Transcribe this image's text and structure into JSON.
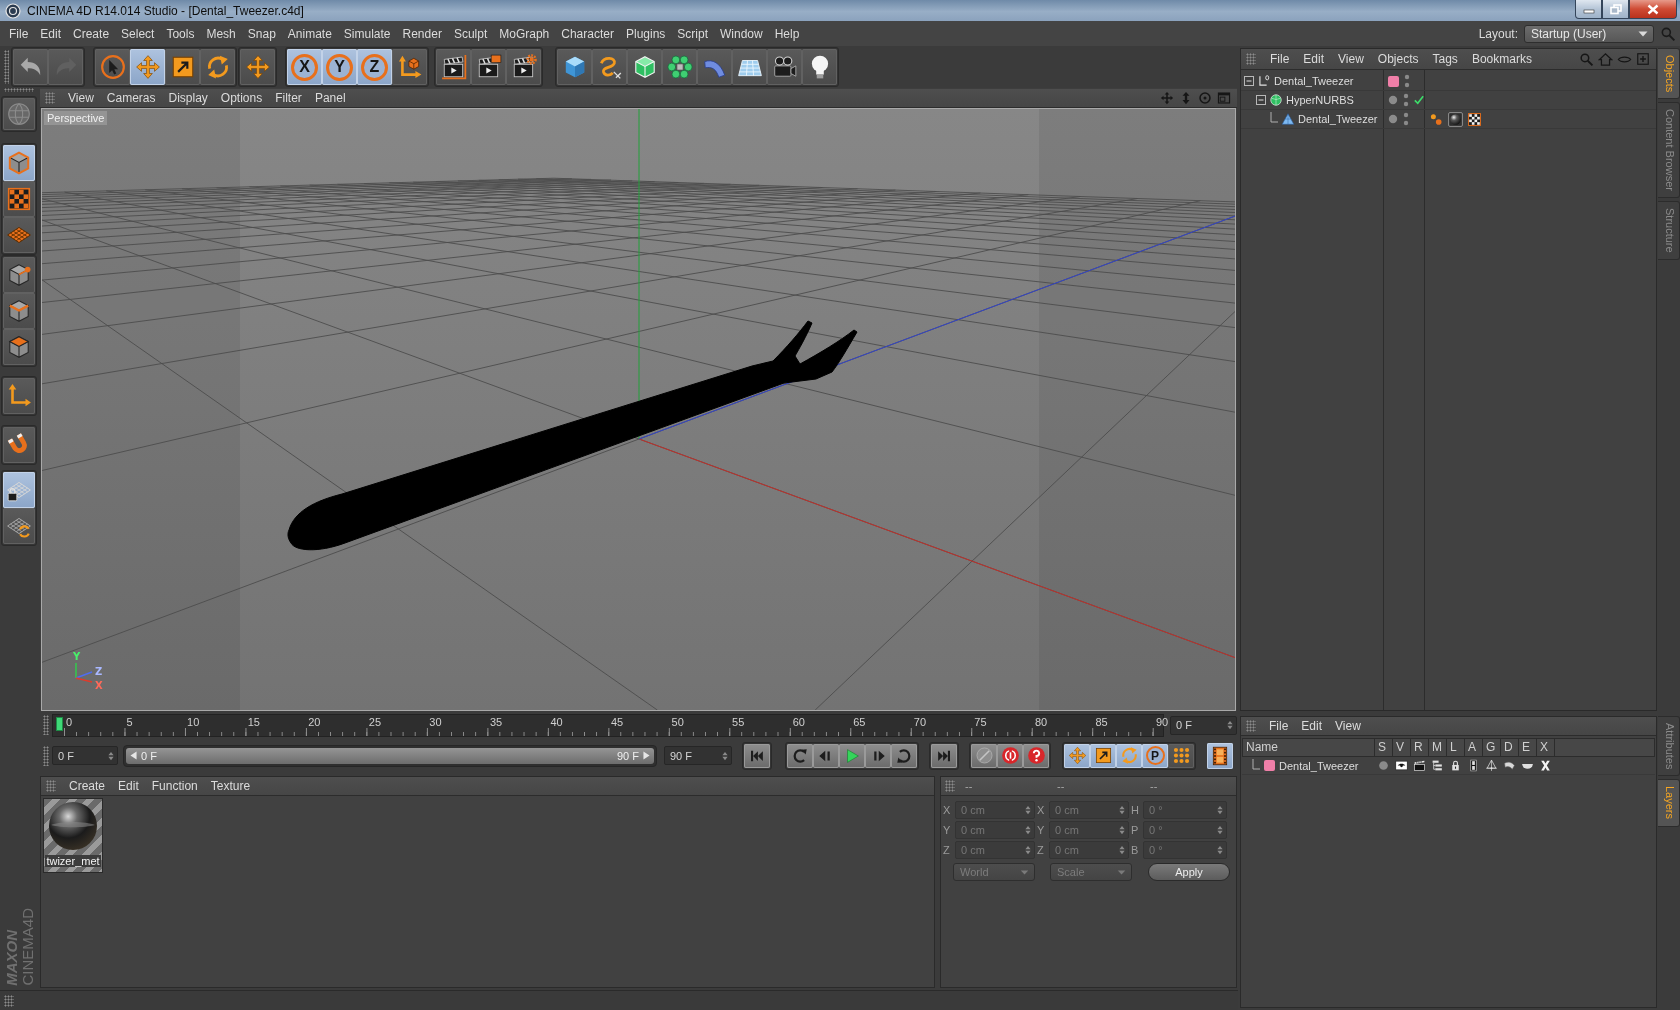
{
  "window": {
    "title": "CINEMA 4D R14.014 Studio - [Dental_Tweezer.c4d]"
  },
  "menu_bar": [
    "File",
    "Edit",
    "Create",
    "Select",
    "Tools",
    "Mesh",
    "Snap",
    "Animate",
    "Simulate",
    "Render",
    "Sculpt",
    "MoGraph",
    "Character",
    "Plugins",
    "Script",
    "Window",
    "Help"
  ],
  "layout": {
    "label": "Layout:",
    "value": "Startup (User)"
  },
  "toolbar": [
    [
      {
        "kind": "undo",
        "selected": false
      },
      {
        "kind": "redo",
        "selected": false
      }
    ],
    [
      {
        "kind": "select",
        "selected": false
      },
      {
        "kind": "move",
        "selected": true
      },
      {
        "kind": "scale",
        "selected": false
      },
      {
        "kind": "rotate",
        "selected": false
      }
    ],
    [
      {
        "kind": "recent",
        "selected": false
      }
    ],
    [
      {
        "kind": "axis",
        "label": "X",
        "selected": true
      },
      {
        "kind": "axis",
        "label": "Y",
        "selected": true
      },
      {
        "kind": "axis",
        "label": "Z",
        "selected": true
      },
      {
        "kind": "coords",
        "selected": false
      }
    ],
    [
      {
        "kind": "render",
        "selected": false
      },
      {
        "kind": "picture",
        "selected": false
      },
      {
        "kind": "settings",
        "selected": false
      }
    ],
    [
      {
        "kind": "cube",
        "selected": false
      },
      {
        "kind": "spline",
        "selected": false
      },
      {
        "kind": "nurbs",
        "selected": false
      },
      {
        "kind": "array",
        "selected": false
      },
      {
        "kind": "deformer",
        "selected": false
      },
      {
        "kind": "floor",
        "selected": false
      },
      {
        "kind": "camera",
        "selected": false
      },
      {
        "kind": "light",
        "selected": false
      }
    ]
  ],
  "left_toolbar": [
    [
      {
        "kind": "editable",
        "selected": false
      }
    ],
    [
      {
        "kind": "model",
        "selected": true
      },
      {
        "kind": "texture",
        "selected": false
      },
      {
        "kind": "workplane",
        "selected": false
      }
    ],
    [
      {
        "kind": "points",
        "selected": false
      },
      {
        "kind": "edges",
        "selected": false
      },
      {
        "kind": "polygons",
        "selected": false
      }
    ],
    [
      {
        "kind": "axismode",
        "selected": false
      }
    ],
    [
      {
        "kind": "snap",
        "selected": false
      }
    ],
    [
      {
        "kind": "lock",
        "selected": true
      },
      {
        "kind": "gridsync",
        "selected": false
      }
    ]
  ],
  "viewport": {
    "menu": [
      "View",
      "Cameras",
      "Display",
      "Options",
      "Filter",
      "Panel"
    ],
    "camera": "Perspective",
    "axis_labels": [
      "Y",
      "Z",
      "X"
    ]
  },
  "timeline": {
    "ticks": [
      "0",
      "5",
      "10",
      "15",
      "20",
      "25",
      "30",
      "35",
      "40",
      "45",
      "50",
      "55",
      "60",
      "65",
      "70",
      "75",
      "80",
      "85",
      "90"
    ],
    "level": 0,
    "frame": "0 F"
  },
  "playback": {
    "start": "0 F",
    "range": {
      "from": "0 F",
      "to": "90 F",
      "level": 1
    },
    "end": "90 F",
    "transport": [
      [
        {
          "kind": "start"
        }
      ],
      [
        {
          "kind": "prevkey"
        },
        {
          "kind": "prevframe"
        },
        {
          "kind": "play"
        },
        {
          "kind": "nextframe"
        },
        {
          "kind": "nextkey"
        }
      ],
      [
        {
          "kind": "end"
        }
      ]
    ],
    "record": [
      {
        "kind": "recordoff"
      },
      {
        "kind": "record"
      },
      {
        "kind": "question"
      }
    ],
    "keys": [
      {
        "kind": "move",
        "selected": true
      },
      {
        "kind": "scale",
        "selected": true
      },
      {
        "kind": "rotate",
        "selected": true
      },
      {
        "kind": "param",
        "label": "P",
        "selected": true
      },
      {
        "kind": "points",
        "selected": false
      }
    ],
    "timeline_button": {
      "selected": true
    }
  },
  "material_manager": {
    "menu": [
      "Create",
      "Edit",
      "Function",
      "Texture"
    ],
    "materials": [
      {
        "name": "twizer_met"
      }
    ]
  },
  "coordinates": {
    "disabled": true,
    "headers": [
      "--",
      "--",
      "--"
    ],
    "rows": [
      [
        {
          "axis": "X",
          "value": "0 cm"
        },
        {
          "axis": "X",
          "value": "0 cm"
        },
        {
          "axis": "H",
          "value": "0 °"
        }
      ],
      [
        {
          "axis": "Y",
          "value": "0 cm"
        },
        {
          "axis": "Y",
          "value": "0 cm"
        },
        {
          "axis": "P",
          "value": "0 °"
        }
      ],
      [
        {
          "axis": "Z",
          "value": "0 cm"
        },
        {
          "axis": "Z",
          "value": "0 cm"
        },
        {
          "axis": "B",
          "value": "0 °"
        }
      ]
    ],
    "dropdowns": [
      "World",
      "Scale"
    ],
    "button": "Apply"
  },
  "object_manager": {
    "menu": [
      "File",
      "Edit",
      "View",
      "Objects",
      "Tags",
      "Bookmarks"
    ],
    "objects": [
      {
        "name": "Dental_Tweezer",
        "kind": "null",
        "color": "#f07fa8",
        "expanded": true,
        "children": [
          {
            "name": "HyperNURBS",
            "kind": "generator",
            "enabled": true,
            "expanded": true,
            "children": [
              {
                "name": "Dental_Tweezer",
                "kind": "polygon",
                "tags": [
                  {
                    "kind": "phong"
                  },
                  {
                    "kind": "material"
                  },
                  {
                    "kind": "uvw"
                  }
                ]
              }
            ]
          }
        ]
      }
    ]
  },
  "layer_manager": {
    "menu": [
      "File",
      "Edit",
      "View"
    ],
    "columns": [
      "Name",
      "S",
      "V",
      "R",
      "M",
      "L",
      "A",
      "G",
      "D",
      "E",
      "X"
    ],
    "layers": [
      {
        "name": "Dental_Tweezer",
        "color": "#f07fa8"
      }
    ]
  },
  "side_tabs": {
    "top": [
      {
        "label": "Objects",
        "selected": true
      },
      {
        "label": "Content Browser",
        "selected": false
      },
      {
        "label": "Structure",
        "selected": false
      }
    ],
    "bottom": [
      {
        "label": "Attributes",
        "selected": false
      },
      {
        "label": "Layers",
        "selected": true
      }
    ]
  },
  "logo": {
    "brand": "MAXON",
    "product": "CINEMA4D"
  }
}
